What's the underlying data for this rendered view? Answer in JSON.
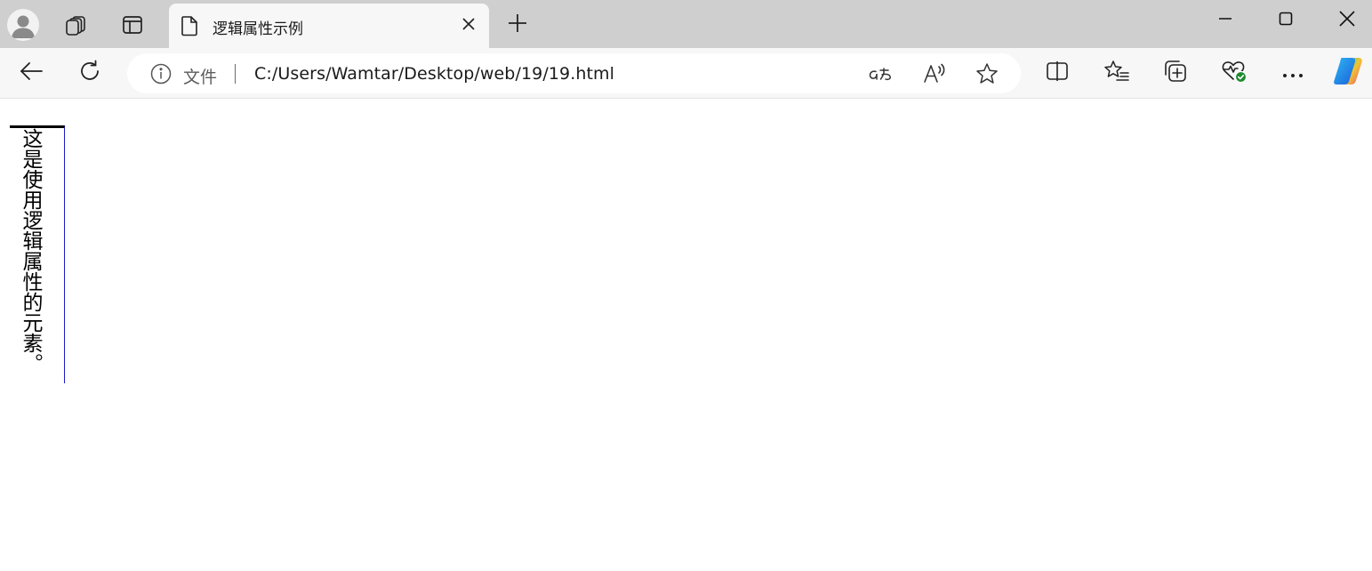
{
  "tab": {
    "title": "逻辑属性示例"
  },
  "address_bar": {
    "site_label": "文件",
    "url": "C:/Users/Wamtar/Desktop/web/19/19.html"
  },
  "icons": {
    "profile": "profile-avatar-icon",
    "workspaces": "workspaces-icon",
    "vertical_tabs": "vertical-tabs-icon",
    "page": "page-icon",
    "close_tab": "close-icon",
    "new_tab": "plus-icon",
    "minimize": "minimize-icon",
    "maximize": "maximize-icon",
    "close_window": "close-icon",
    "back": "back-arrow-icon",
    "refresh": "refresh-icon",
    "site_info": "info-icon",
    "translate": "translate-icon",
    "read_aloud": "read-aloud-icon",
    "favorite": "star-icon",
    "split_screen": "split-screen-icon",
    "favorites": "favorites-list-icon",
    "collections": "collections-icon",
    "browser_essentials": "heart-pulse-icon",
    "more": "more-dots-icon",
    "copilot": "copilot-icon"
  },
  "content": {
    "vertical_text": "这是使用逻辑属性的元素。"
  },
  "colors": {
    "tabstrip_bg": "#cfcfcf",
    "toolbar_bg": "#f7f7f7",
    "box_top_border": "#000000",
    "box_right_border": "#1a1acc",
    "essentials_badge": "#1e8a2e"
  }
}
